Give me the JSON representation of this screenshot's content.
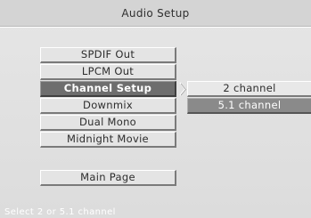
{
  "header": {
    "title": "Audio Setup"
  },
  "menu": {
    "items": [
      {
        "label": "SPDIF Out"
      },
      {
        "label": "LPCM Out"
      },
      {
        "label": "Channel Setup"
      },
      {
        "label": "Downmix"
      },
      {
        "label": "Dual Mono"
      },
      {
        "label": "Midnight Movie"
      }
    ],
    "active_index": 2,
    "main_page_label": "Main Page"
  },
  "submenu": {
    "options": [
      {
        "label": "2 channel"
      },
      {
        "label": "5.1 channel"
      }
    ],
    "selected_index": 1
  },
  "status": {
    "hint": "Select 2 or 5.1 channel"
  },
  "colors": {
    "background": "#e3e3e3",
    "highlight": "#6e6e6e",
    "selected_option": "#8a8a8a",
    "text": "#2d2d2d"
  }
}
